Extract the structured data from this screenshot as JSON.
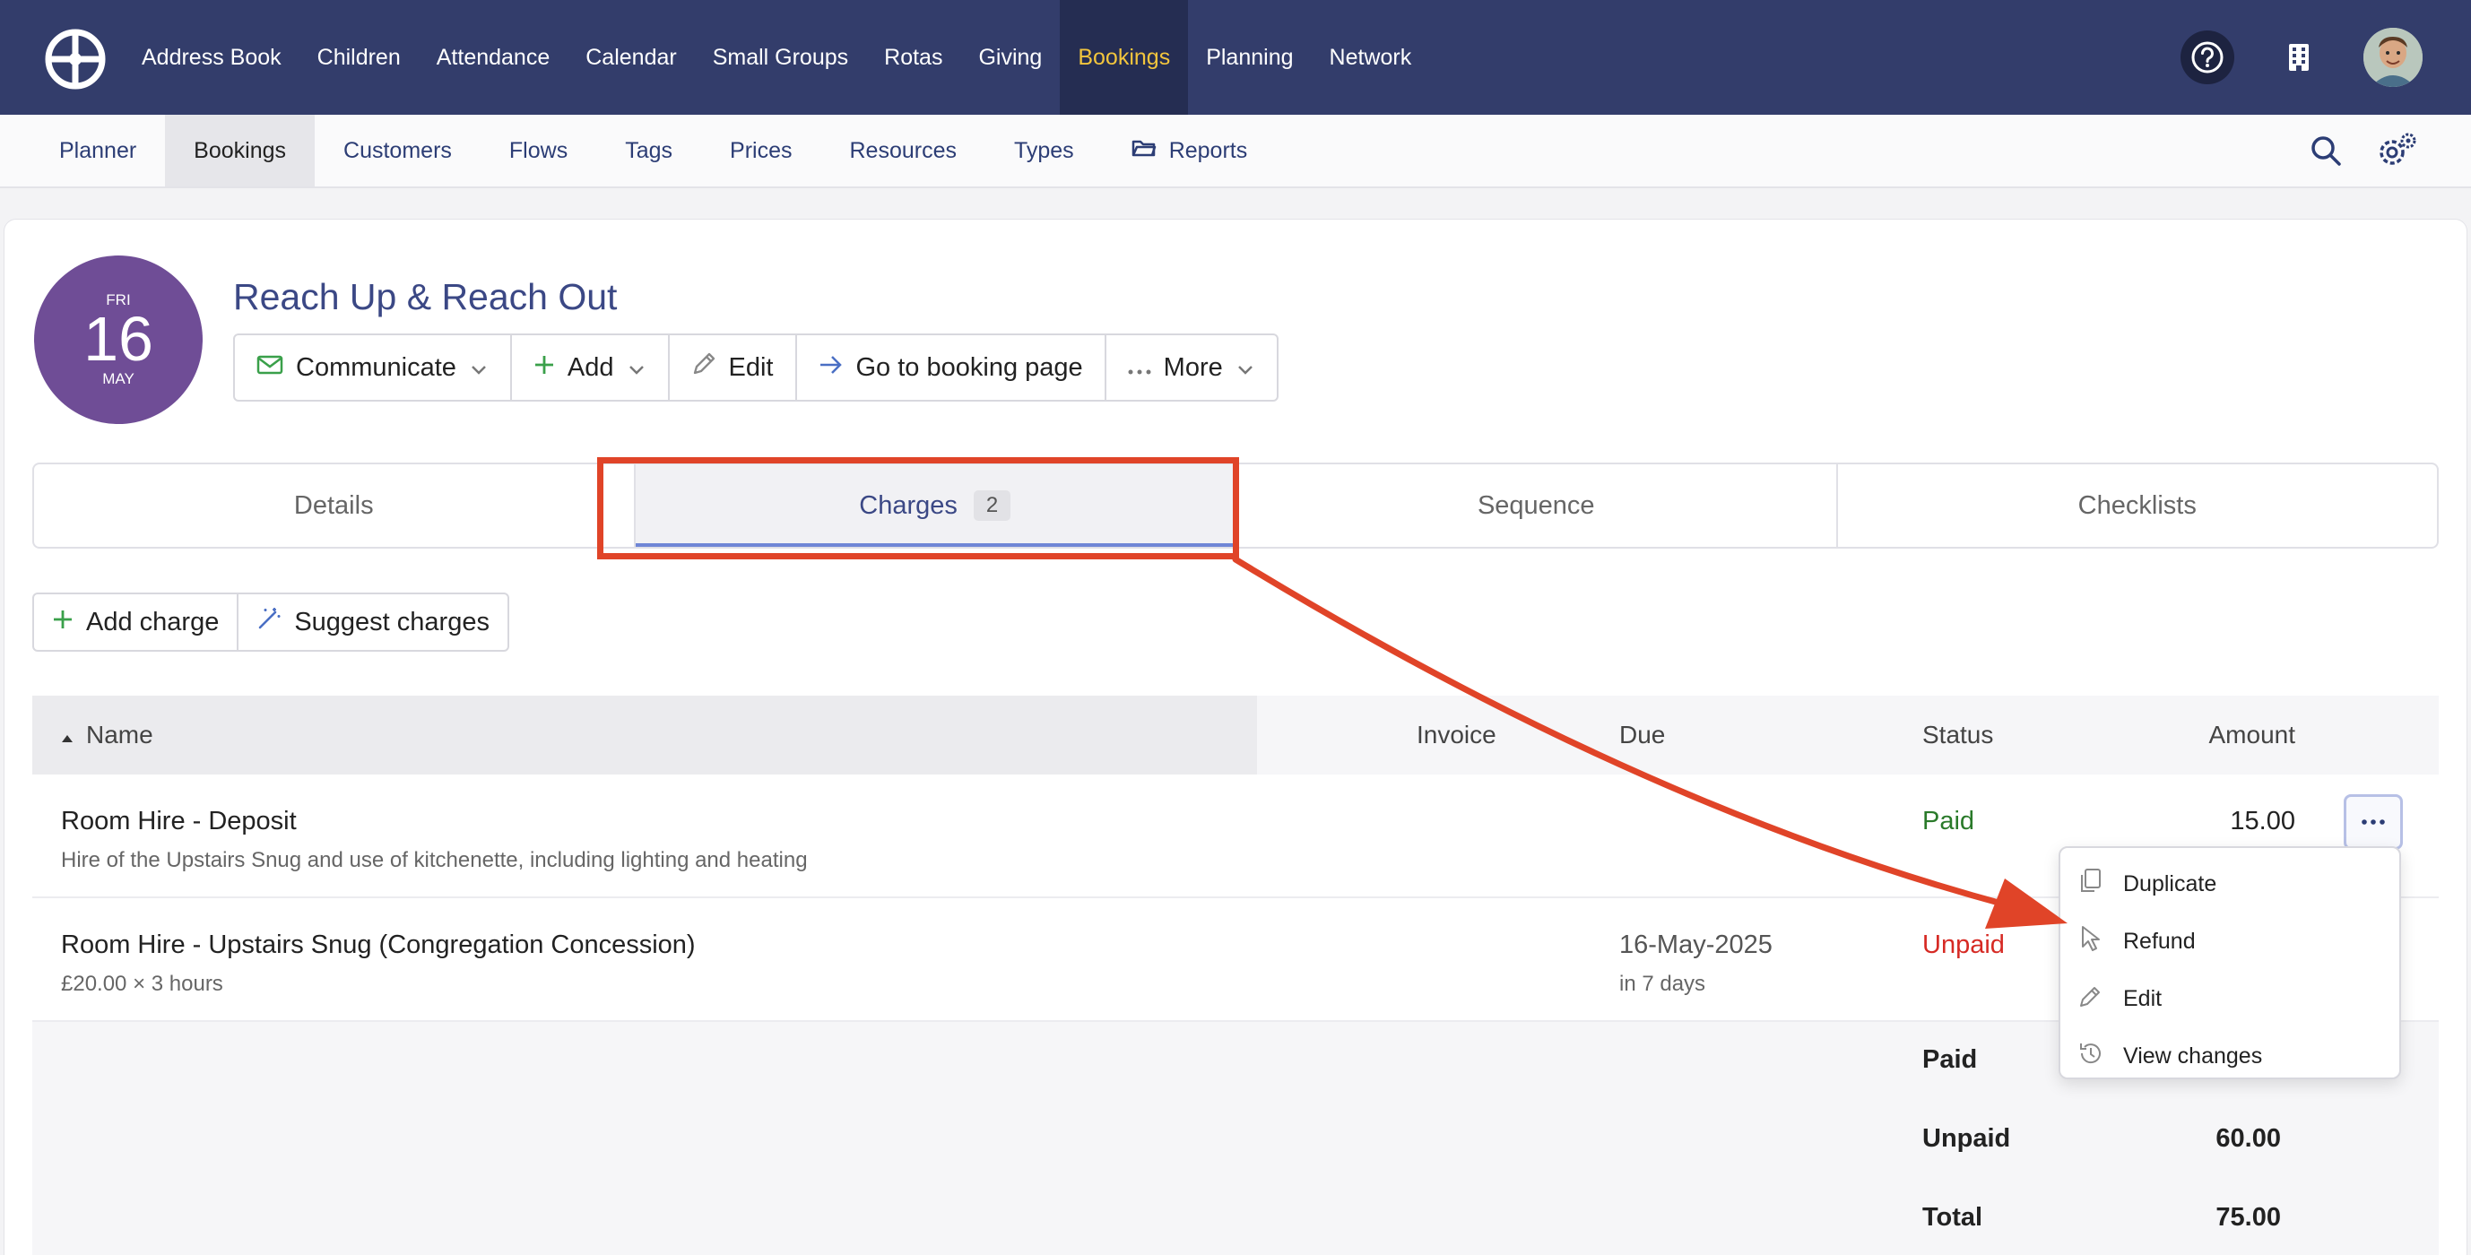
{
  "topnav": {
    "items": [
      {
        "label": "Address Book"
      },
      {
        "label": "Children"
      },
      {
        "label": "Attendance"
      },
      {
        "label": "Calendar"
      },
      {
        "label": "Small Groups"
      },
      {
        "label": "Rotas"
      },
      {
        "label": "Giving"
      },
      {
        "label": "Bookings",
        "active": true
      },
      {
        "label": "Planning"
      },
      {
        "label": "Network"
      }
    ]
  },
  "subnav": {
    "items": [
      {
        "label": "Planner"
      },
      {
        "label": "Bookings",
        "active": true
      },
      {
        "label": "Customers"
      },
      {
        "label": "Flows"
      },
      {
        "label": "Tags"
      },
      {
        "label": "Prices"
      },
      {
        "label": "Resources"
      },
      {
        "label": "Types"
      },
      {
        "label": "Reports"
      }
    ]
  },
  "booking": {
    "date": {
      "dow": "FRI",
      "day": "16",
      "month": "MAY"
    },
    "title": "Reach Up & Reach Out",
    "actions": {
      "communicate": "Communicate",
      "add": "Add",
      "edit": "Edit",
      "go_to_booking_page": "Go to booking page",
      "more": "More"
    }
  },
  "tabs": {
    "details": "Details",
    "charges": "Charges",
    "charges_count": "2",
    "sequence": "Sequence",
    "checklists": "Checklists"
  },
  "charge_actions": {
    "add_charge": "Add charge",
    "suggest_charges": "Suggest charges"
  },
  "table": {
    "headers": {
      "name": "Name",
      "invoice": "Invoice",
      "due": "Due",
      "status": "Status",
      "amount": "Amount"
    },
    "rows": [
      {
        "name": "Room Hire - Deposit",
        "description": "Hire of the Upstairs Snug and use of kitchenette, including lighting and heating",
        "due": "",
        "due_relative": "",
        "status": "Paid",
        "amount": "15.00"
      },
      {
        "name": "Room Hire - Upstairs Snug (Congregation Concession)",
        "description": "£20.00 × 3 hours",
        "due": "16-May-2025",
        "due_relative": "in 7 days",
        "status": "Unpaid",
        "amount": ""
      }
    ],
    "totals": {
      "paid_label": "Paid",
      "paid_value": "",
      "unpaid_label": "Unpaid",
      "unpaid_value": "60.00",
      "total_label": "Total",
      "total_value": "75.00"
    }
  },
  "row_menu": {
    "items": [
      {
        "label": "Duplicate",
        "icon": "copy-icon"
      },
      {
        "label": "Refund",
        "icon": "cursor-icon"
      },
      {
        "label": "Edit",
        "icon": "pencil-icon"
      },
      {
        "label": "View changes",
        "icon": "history-icon"
      }
    ]
  },
  "colors": {
    "topnav_bg": "#333d6b",
    "active_nav_text": "#f2c53d",
    "date_badge": "#6f4d96",
    "paid": "#2a7a2a",
    "unpaid": "#d62a24",
    "annotation": "#e04428"
  }
}
